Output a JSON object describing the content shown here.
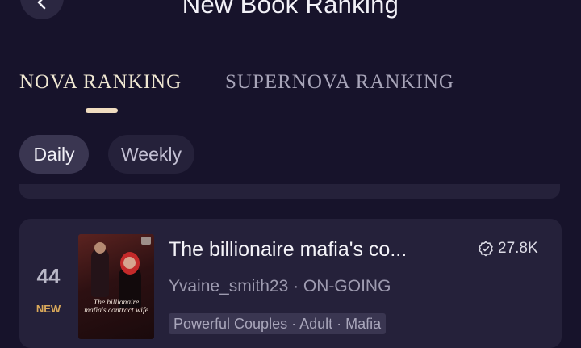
{
  "header": {
    "title": "New Book Ranking",
    "back_icon": "chevron-left-icon"
  },
  "tabs": [
    {
      "label": "NOVA RANKING",
      "active": true
    },
    {
      "label": "SUPERNOVA RANKING",
      "active": false
    }
  ],
  "filters": [
    {
      "label": "Daily",
      "active": true
    },
    {
      "label": "Weekly",
      "active": false
    }
  ],
  "book": {
    "rank": "44",
    "badge": "NEW",
    "title": "The billionaire mafia's co...",
    "reads": "27.8K",
    "reads_icon": "verified-badge-icon",
    "meta": "Yvaine_smith23 · ON-GOING",
    "tags": "Powerful Couples · Adult · Mafia",
    "cover_text": "The billionaire mafia's contract wife"
  },
  "colors": {
    "background": "#17132b",
    "card": "#25213a",
    "accent": "#f0dcc0",
    "badge": "#d9a85a"
  }
}
